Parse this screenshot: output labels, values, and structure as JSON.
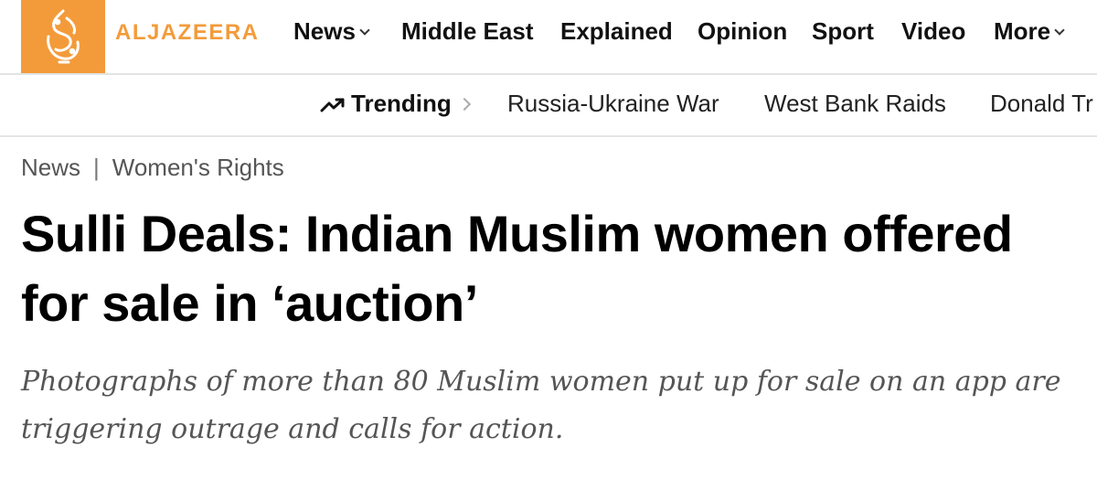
{
  "brand": {
    "name": "ALJAZEERA",
    "accent": "#f39b3a"
  },
  "nav": {
    "items": [
      {
        "label": "News",
        "dropdown": true
      },
      {
        "label": "Middle East",
        "dropdown": false
      },
      {
        "label": "Explained",
        "dropdown": false
      },
      {
        "label": "Opinion",
        "dropdown": false
      },
      {
        "label": "Sport",
        "dropdown": false
      },
      {
        "label": "Video",
        "dropdown": false
      },
      {
        "label": "More",
        "dropdown": true
      }
    ]
  },
  "trending": {
    "label": "Trending",
    "links": [
      "Russia-Ukraine War",
      "West Bank Raids",
      "Donald Tr"
    ]
  },
  "breadcrumb": {
    "section": "News",
    "separator": "|",
    "topic": "Women's Rights"
  },
  "article": {
    "headline": "Sulli Deals: Indian Muslim women offered for sale in ‘auction’",
    "subhead": "Photographs of more than 80 Muslim women put up for sale on an app are triggering outrage and calls for action."
  }
}
